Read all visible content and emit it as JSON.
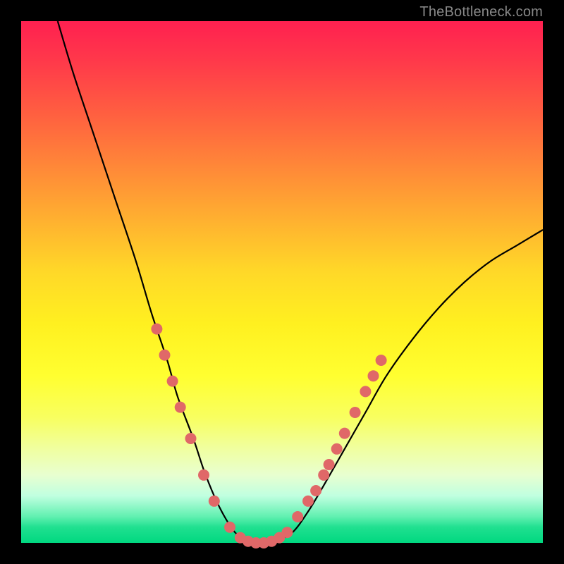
{
  "watermark": "TheBottleneck.com",
  "chart_data": {
    "type": "line",
    "title": "",
    "xlabel": "",
    "ylabel": "",
    "xlim": [
      0,
      100
    ],
    "ylim": [
      0,
      100
    ],
    "grid": false,
    "series": [
      {
        "name": "bottleneck-curve",
        "color": "#000000",
        "x": [
          7,
          10,
          14,
          18,
          22,
          25,
          28,
          30,
          33,
          35,
          37,
          39,
          41,
          43,
          45,
          47,
          49,
          52,
          55,
          58,
          62,
          66,
          70,
          75,
          80,
          85,
          90,
          95,
          100
        ],
        "y": [
          100,
          90,
          78,
          66,
          54,
          44,
          35,
          28,
          20,
          14,
          9,
          5,
          2,
          0.5,
          0,
          0,
          0.5,
          2,
          6,
          11,
          18,
          25,
          32,
          39,
          45,
          50,
          54,
          57,
          60
        ]
      }
    ],
    "markers": {
      "name": "highlight-dots",
      "color": "#e06868",
      "radius": 8,
      "points": [
        {
          "x": 26,
          "y": 41
        },
        {
          "x": 27.5,
          "y": 36
        },
        {
          "x": 29,
          "y": 31
        },
        {
          "x": 30.5,
          "y": 26
        },
        {
          "x": 32.5,
          "y": 20
        },
        {
          "x": 35,
          "y": 13
        },
        {
          "x": 37,
          "y": 8
        },
        {
          "x": 40,
          "y": 3
        },
        {
          "x": 42,
          "y": 1
        },
        {
          "x": 43.5,
          "y": 0.3
        },
        {
          "x": 45,
          "y": 0
        },
        {
          "x": 46.5,
          "y": 0
        },
        {
          "x": 48,
          "y": 0.3
        },
        {
          "x": 49.5,
          "y": 1
        },
        {
          "x": 51,
          "y": 2
        },
        {
          "x": 53,
          "y": 5
        },
        {
          "x": 55,
          "y": 8
        },
        {
          "x": 56.5,
          "y": 10
        },
        {
          "x": 58,
          "y": 13
        },
        {
          "x": 59,
          "y": 15
        },
        {
          "x": 60.5,
          "y": 18
        },
        {
          "x": 62,
          "y": 21
        },
        {
          "x": 64,
          "y": 25
        },
        {
          "x": 66,
          "y": 29
        },
        {
          "x": 67.5,
          "y": 32
        },
        {
          "x": 69,
          "y": 35
        }
      ]
    }
  }
}
